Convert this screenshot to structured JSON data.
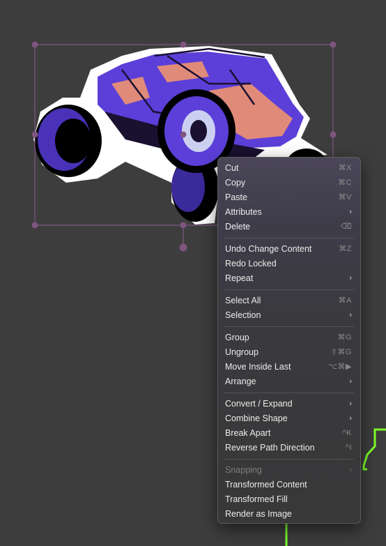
{
  "menu": {
    "cut": {
      "label": "Cut",
      "shortcut": "⌘X"
    },
    "copy": {
      "label": "Copy",
      "shortcut": "⌘C"
    },
    "paste": {
      "label": "Paste",
      "shortcut": "⌘V"
    },
    "attributes": {
      "label": "Attributes"
    },
    "delete": {
      "label": "Delete",
      "shortcut": "⌫"
    },
    "undo": {
      "label": "Undo Change Content",
      "shortcut": "⌘Z"
    },
    "redo": {
      "label": "Redo Locked"
    },
    "repeat": {
      "label": "Repeat"
    },
    "select_all": {
      "label": "Select All",
      "shortcut": "⌘A"
    },
    "selection": {
      "label": "Selection"
    },
    "group": {
      "label": "Group",
      "shortcut": "⌘G"
    },
    "ungroup": {
      "label": "Ungroup",
      "shortcut": "⇧⌘G"
    },
    "move_inside_last": {
      "label": "Move Inside Last",
      "shortcut": "⌥⌘▶"
    },
    "arrange": {
      "label": "Arrange"
    },
    "convert_expand": {
      "label": "Convert / Expand"
    },
    "combine_shape": {
      "label": "Combine Shape"
    },
    "break_apart": {
      "label": "Break Apart",
      "shortcut": "^K"
    },
    "reverse_path": {
      "label": "Reverse Path Direction",
      "shortcut": "^I"
    },
    "snapping": {
      "label": "Snapping"
    },
    "transformed_content": {
      "label": "Transformed Content"
    },
    "transformed_fill": {
      "label": "Transformed Fill"
    },
    "render_as_image": {
      "label": "Render as Image"
    }
  },
  "icons": {
    "submenu": "chevron-right-icon"
  },
  "colors": {
    "canvas": "#3d3d3d",
    "selection_outline": "#8e5c8e",
    "accent_path": "#7dff2a",
    "artwork_purple": "#5b3fd8",
    "artwork_salmon": "#e08a7a"
  }
}
